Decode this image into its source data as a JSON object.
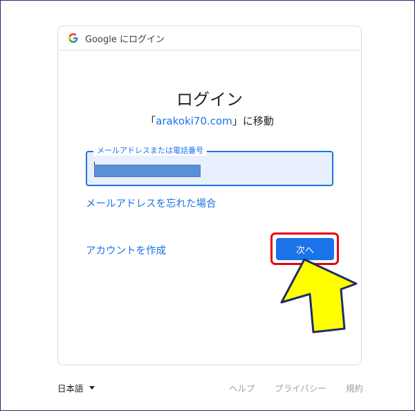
{
  "header": {
    "title": "Google にログイン"
  },
  "main": {
    "title": "ログイン",
    "subtitle_prefix": "「",
    "subtitle_domain": "arakoki70.com",
    "subtitle_suffix": "」に移動",
    "email_label": "メールアドレスまたは電話番号",
    "forgot_link": "メールアドレスを忘れた場合",
    "create_link": "アカウントを作成",
    "next_button": "次へ"
  },
  "footer": {
    "language": "日本語",
    "help": "ヘルプ",
    "privacy": "プライバシー",
    "terms": "規約"
  },
  "colors": {
    "accent": "#1a73e8",
    "highlight": "#e60012",
    "arrow": "#ffff00"
  }
}
